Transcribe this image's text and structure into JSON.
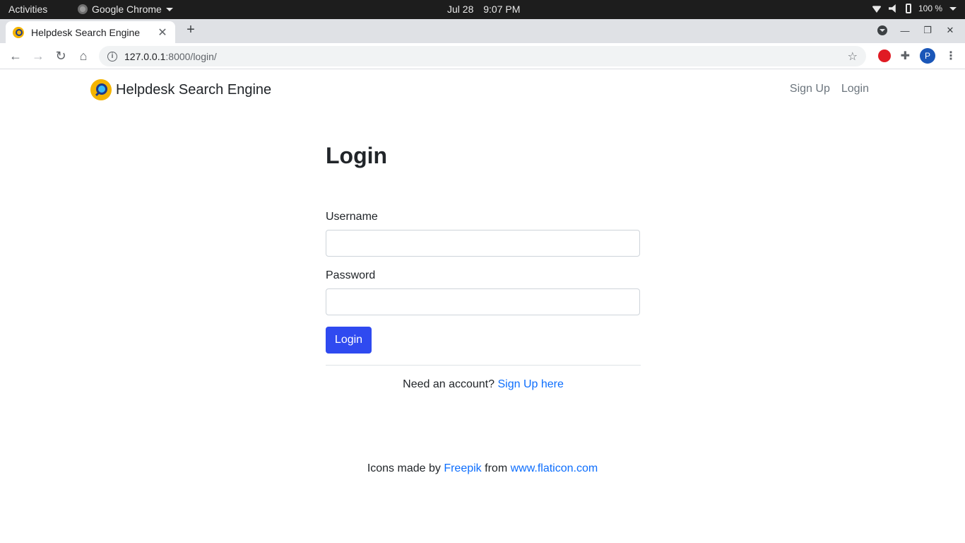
{
  "system_bar": {
    "activities": "Activities",
    "app_name": "Google Chrome",
    "date": "Jul 28",
    "time": "9:07 PM",
    "battery": "100 %"
  },
  "browser": {
    "tab_title": "Helpdesk Search Engine",
    "url_host": "127.0.0.1",
    "url_rest": ":8000/login/",
    "profile_initial": "P"
  },
  "navbar": {
    "brand": "Helpdesk Search Engine",
    "signup": "Sign Up",
    "login": "Login"
  },
  "form": {
    "title": "Login",
    "username_label": "Username",
    "username_value": "",
    "password_label": "Password",
    "password_value": "",
    "submit": "Login",
    "need_account": "Need an account?",
    "signup_link": "Sign Up here"
  },
  "footer": {
    "prefix": "Icons made by",
    "author": "Freepik",
    "middle": "from",
    "site": "www.flaticon.com"
  }
}
